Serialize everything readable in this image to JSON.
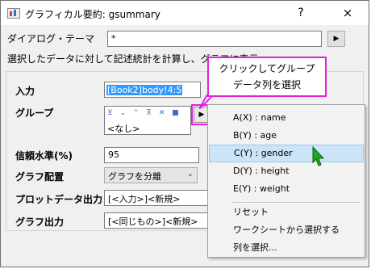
{
  "window": {
    "title": "グラフィカル要約: gsummary",
    "help": "?",
    "close": "×"
  },
  "dialog_theme": {
    "label": "ダイアログ・テーマ",
    "value": "*",
    "button": "▶"
  },
  "description": "選択したデータに対して記述統計を計算し、グラフに表示",
  "callout": {
    "line1": "クリックしてグループ",
    "line2": "データ列を選択"
  },
  "form": {
    "input_label": "入力",
    "input_value": "[Book2]body!4:5",
    "group_label": "グループ",
    "group_icons": "⊻ ⌄ ⌃ ⊼ ✕ ■",
    "group_value": "<なし>",
    "group_button": "▶",
    "confidence_label": "信頼水準(%)",
    "confidence_value": "95",
    "layout_label": "グラフ配置",
    "layout_value": "グラフを分離",
    "plot_output_label": "プロットデータ出力",
    "plot_output_value": "[<入力>]<新規>",
    "graph_output_label": "グラフ出力",
    "graph_output_value": "[<同じもの>]<新規>"
  },
  "menu": {
    "columns": [
      "A(X) : name",
      "B(Y) : age",
      "C(Y) : gender",
      "D(Y) : height",
      "E(Y) : weight"
    ],
    "highlighted": "C(Y) : gender",
    "reset": "リセット",
    "select_from_worksheet": "ワークシートから選択する",
    "select_column": "列を選択..."
  }
}
